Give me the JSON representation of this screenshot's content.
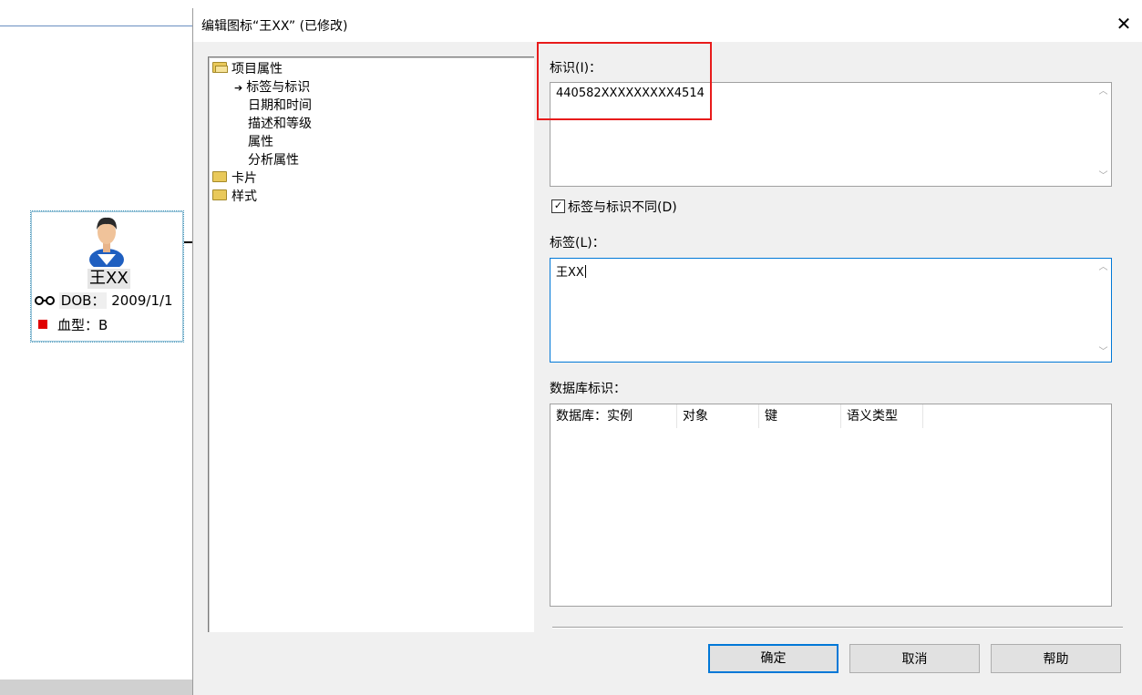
{
  "canvas": {
    "entity": {
      "name": "王XX",
      "dob_label": "DOB：",
      "dob_value": "2009/1/1",
      "blood_type": "血型：B"
    }
  },
  "dialog": {
    "title": "编辑图标“王XX” (已修改)",
    "close_icon": "close-icon",
    "tree": {
      "root1": "项目属性",
      "child1": "标签与标识",
      "child2": "日期和时间",
      "child3": "描述和等级",
      "child4": "属性",
      "child5": "分析属性",
      "root2": "卡片",
      "root3": "样式"
    },
    "identity_label": "标识(I)：",
    "identity_value": "440582XXXXXXXXX4514",
    "checkbox_label": "标签与标识不同(D)",
    "checkbox_checked": true,
    "label_label": "标签(L)：",
    "label_value": "王XX",
    "db_label": "数据库标识：",
    "db_columns": [
      "数据库：实例",
      "对象",
      "键",
      "语义类型"
    ],
    "buttons": {
      "ok": "确定",
      "cancel": "取消",
      "help": "帮助"
    },
    "highlight_color": "#e81b1b",
    "accent": "#0078d7"
  }
}
